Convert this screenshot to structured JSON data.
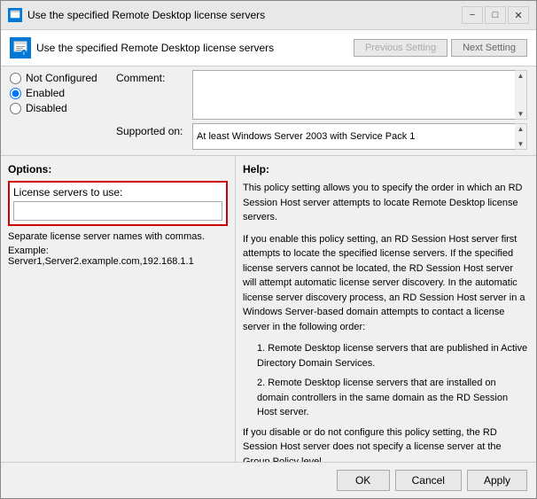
{
  "window": {
    "title": "Use the specified Remote Desktop license servers",
    "header_title": "Use the specified Remote Desktop license servers"
  },
  "nav": {
    "prev_label": "Previous Setting",
    "next_label": "Next Setting"
  },
  "radio": {
    "not_configured_label": "Not Configured",
    "enabled_label": "Enabled",
    "disabled_label": "Disabled",
    "selected": "enabled"
  },
  "comment": {
    "label": "Comment:",
    "value": ""
  },
  "supported": {
    "label": "Supported on:",
    "value": "At least Windows Server 2003 with Service Pack 1"
  },
  "options": {
    "title": "Options:",
    "license_label": "License servers to use:",
    "license_value": "",
    "separate_note": "Separate license server names with commas.",
    "example_note": "Example: Server1,Server2.example.com,192.168.1.1"
  },
  "help": {
    "title": "Help:",
    "paragraphs": [
      "This policy setting allows you to specify the order in which an RD Session Host server attempts to locate Remote Desktop license servers.",
      "If you enable this policy setting, an RD Session Host server first attempts to locate the specified license servers. If the specified license servers cannot be located, the RD Session Host server will attempt automatic license server discovery. In the automatic license server discovery process, an RD Session Host server in a Windows Server-based domain attempts to contact a license server in the following order:",
      "1. Remote Desktop license servers that are published in Active Directory Domain Services.",
      "2. Remote Desktop license servers that are installed on domain controllers in the same domain as the RD Session Host server.",
      "If you disable or do not configure this policy setting, the RD Session Host server does not specify a license server at the Group Policy level."
    ]
  },
  "footer": {
    "ok_label": "OK",
    "cancel_label": "Cancel",
    "apply_label": "Apply"
  }
}
